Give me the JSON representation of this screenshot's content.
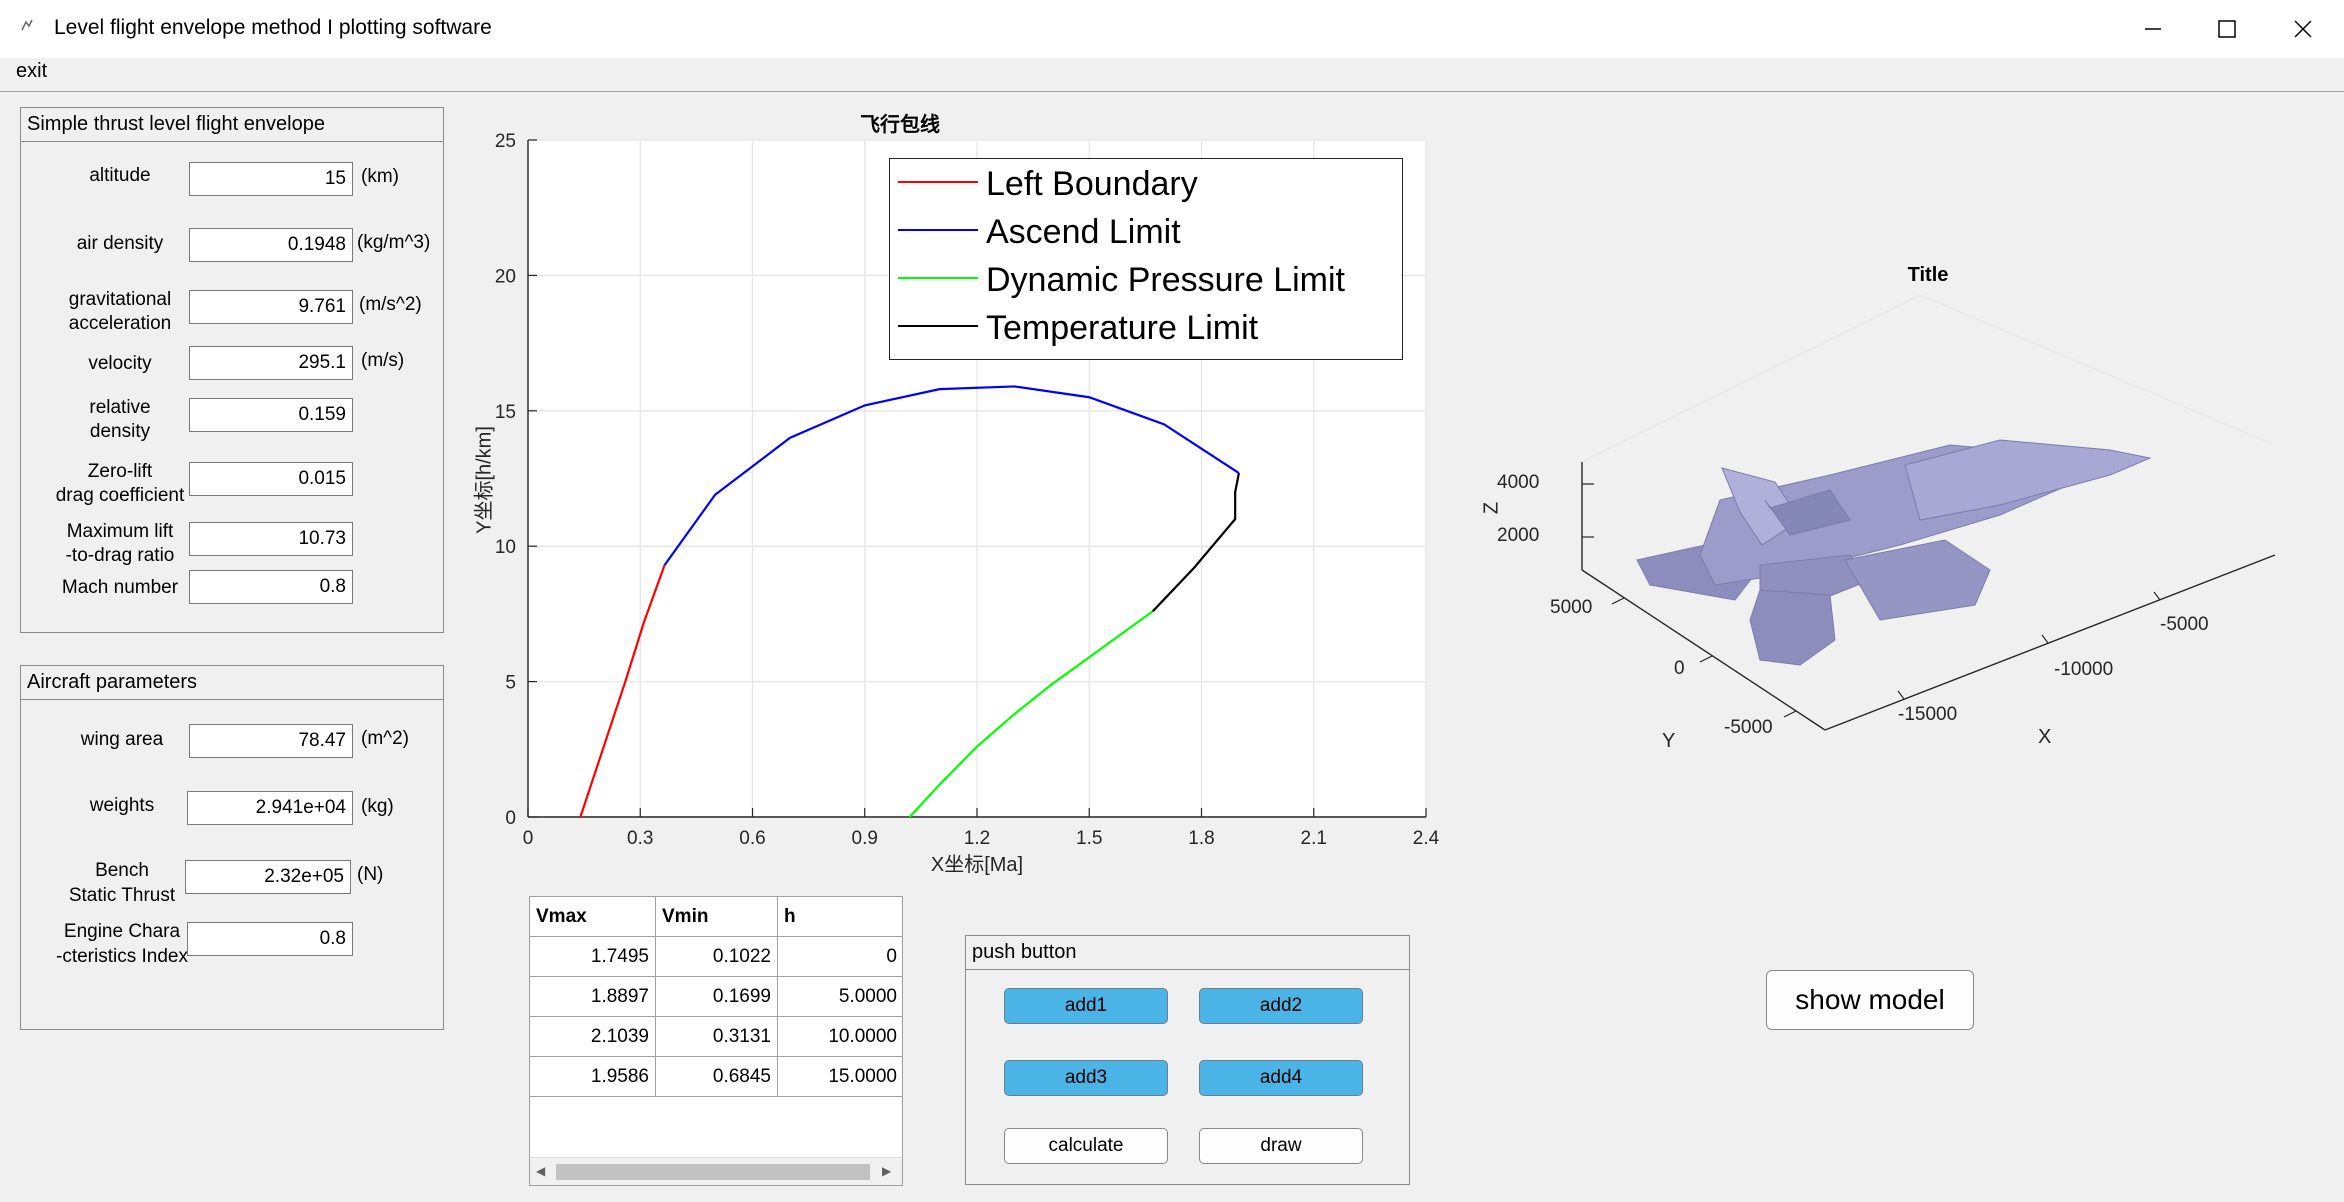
{
  "window": {
    "title": "Level flight envelope method I plotting software",
    "icon": "matlab-figure-icon"
  },
  "menu": {
    "exit": "exit"
  },
  "panel1": {
    "title": "Simple thrust level flight envelope",
    "rows": [
      {
        "label": "altitude",
        "value": "15",
        "unit": "(km)"
      },
      {
        "label": "air density",
        "value": "0.1948",
        "unit": "(kg/m^3)"
      },
      {
        "label1": "gravitational",
        "label2": "acceleration",
        "value": "9.761",
        "unit": "(m/s^2)"
      },
      {
        "label": "velocity",
        "value": "295.1",
        "unit": "(m/s)"
      },
      {
        "label1": "relative",
        "label2": "density",
        "value": "0.159"
      },
      {
        "label1": "Zero-lift",
        "label2": "drag coefficient",
        "value": "0.015"
      },
      {
        "label1": "Maximum lift",
        "label2": "-to-drag ratio",
        "value": "10.73"
      },
      {
        "label": "Mach number",
        "value": "0.8"
      }
    ]
  },
  "panel2": {
    "title": "Aircraft parameters",
    "rows": [
      {
        "label": "wing area",
        "value": "78.47",
        "unit": "(m^2)"
      },
      {
        "label": "weights",
        "value": "2.941e+04",
        "unit": "(kg)"
      },
      {
        "label1": "Bench",
        "label2": "Static Thrust",
        "value": "2.32e+05",
        "unit": "(N)"
      },
      {
        "label1": "Engine Chara",
        "label2": "-cteristics Index",
        "value": "0.8"
      }
    ]
  },
  "chart_data": [
    {
      "type": "line",
      "title": "飞行包线",
      "xlabel": "X坐标[Ma]",
      "ylabel": "Y坐标[h/km]",
      "xlim": [
        0,
        2.4
      ],
      "ylim": [
        0,
        25
      ],
      "xticks": [
        "0",
        "0.3",
        "0.6",
        "0.9",
        "1.2",
        "1.5",
        "1.8",
        "2.1",
        "2.4"
      ],
      "yticks": [
        "0",
        "5",
        "10",
        "15",
        "20",
        "25"
      ],
      "grid": true,
      "legend_position": "top-right",
      "series": [
        {
          "name": "Left Boundary",
          "color": "#ff0000",
          "x": [
            0.14,
            0.2,
            0.26,
            0.31,
            0.365
          ],
          "y": [
            0,
            2.5,
            5,
            7.2,
            9.3
          ]
        },
        {
          "name": "Ascend Limit",
          "color": "#0000ff",
          "x": [
            0.365,
            0.5,
            0.7,
            0.9,
            1.1,
            1.3,
            1.5,
            1.7,
            1.9
          ],
          "y": [
            9.3,
            11.9,
            14.0,
            15.2,
            15.8,
            15.9,
            15.5,
            14.5,
            12.7
          ]
        },
        {
          "name": "Dynamic Pressure Limit",
          "color": "#00ff00",
          "x": [
            1.02,
            1.1,
            1.2,
            1.3,
            1.4,
            1.5,
            1.6,
            1.67
          ],
          "y": [
            0,
            1.2,
            2.6,
            3.8,
            4.9,
            5.9,
            6.9,
            7.6
          ]
        },
        {
          "name": "Temperature Limit",
          "color": "#000000",
          "x": [
            1.67,
            1.78,
            1.89,
            1.89,
            1.9
          ],
          "y": [
            7.6,
            9.2,
            11.0,
            12.0,
            12.7
          ]
        }
      ]
    },
    {
      "type": "3d-model",
      "title": "Title",
      "xlabel": "X",
      "ylabel": "Y",
      "zlabel": "Z",
      "xticks": [
        "-5000",
        "-10000",
        "-15000"
      ],
      "yticks": [
        "5000",
        "0",
        "-5000"
      ],
      "zticks": [
        "4000",
        "2000"
      ],
      "model_color": "#9b9cc9"
    }
  ],
  "table": {
    "headers": [
      "Vmax",
      "Vmin",
      "h"
    ],
    "rows": [
      [
        "1.7495",
        "0.1022",
        "0"
      ],
      [
        "1.8897",
        "0.1699",
        "5.0000"
      ],
      [
        "2.1039",
        "0.3131",
        "10.0000"
      ],
      [
        "1.9586",
        "0.6845",
        "15.0000"
      ]
    ]
  },
  "buttons_panel": {
    "title": "push button",
    "add1": "add1",
    "add2": "add2",
    "add3": "add3",
    "add4": "add4",
    "calculate": "calculate",
    "draw": "draw"
  },
  "show_model": "show model"
}
